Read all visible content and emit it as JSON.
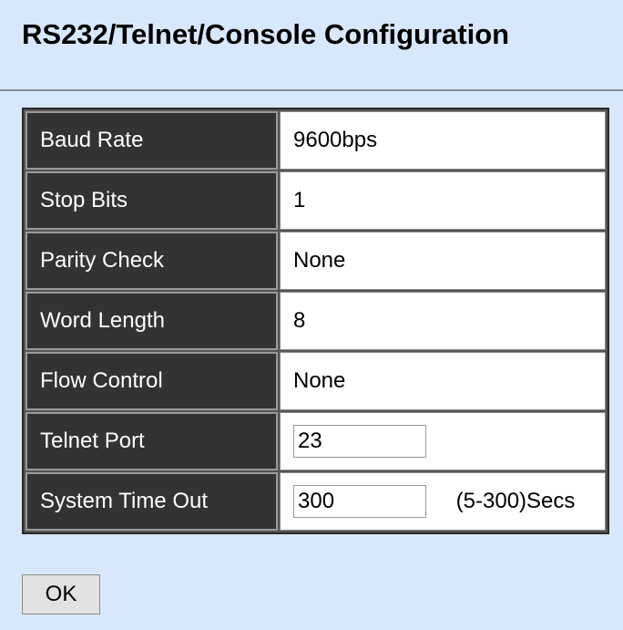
{
  "page": {
    "title": "RS232/Telnet/Console Configuration"
  },
  "config": {
    "rows": [
      {
        "label": "Baud Rate",
        "value": "9600bps"
      },
      {
        "label": "Stop Bits",
        "value": "1"
      },
      {
        "label": "Parity Check",
        "value": "None"
      },
      {
        "label": "Word Length",
        "value": "8"
      },
      {
        "label": "Flow Control",
        "value": "None"
      }
    ],
    "telnet_port": {
      "label": "Telnet Port",
      "value": "23"
    },
    "system_timeout": {
      "label": "System Time Out",
      "value": "300",
      "range_hint": "(5-300)Secs"
    }
  },
  "actions": {
    "ok_label": "OK"
  }
}
